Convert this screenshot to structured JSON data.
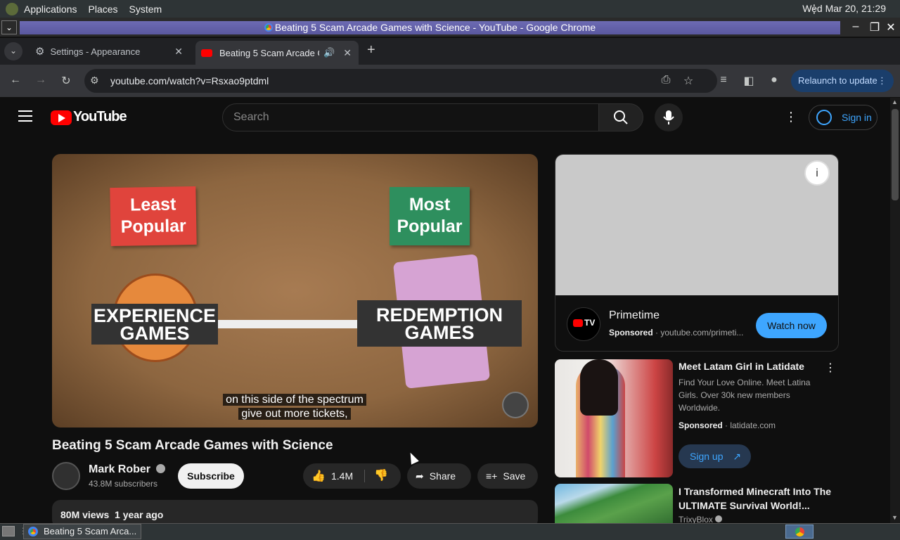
{
  "desktop": {
    "menus": [
      "Applications",
      "Places",
      "System"
    ],
    "clock": "Wed Mar 20, 21:29"
  },
  "window": {
    "title": "Beating 5 Scam Arcade Games with Science - YouTube - Google Chrome"
  },
  "tabs": [
    {
      "label": "Settings - Appearance"
    },
    {
      "label": "Beating 5 Scam Arcade G"
    }
  ],
  "toolbar": {
    "url": "youtube.com/watch?v=Rsxao9ptdml",
    "relaunch_label": "Relaunch to update"
  },
  "youtube": {
    "logo_text": "YouTube",
    "search_placeholder": "Search",
    "signin_label": "Sign in",
    "video": {
      "notes": [
        "Least Popular",
        "Most Popular"
      ],
      "labels": [
        "EXPERIENCE GAMES",
        "REDEMPTION GAMES"
      ],
      "caption_line1": "on this side of the spectrum",
      "caption_line2": "give out more tickets,"
    },
    "title": "Beating 5 Scam Arcade Games with Science",
    "channel": "Mark Rober",
    "subscribers": "43.8M subscribers",
    "subscribe_label": "Subscribe",
    "likes": "1.4M",
    "share_label": "Share",
    "save_label": "Save",
    "views_date": "80M views  1 year ago",
    "ad": {
      "title": "Primetime",
      "sponsored": "Sponsored",
      "domain": "youtube.com/primeti...",
      "cta": "Watch now",
      "logo_text": "TV"
    },
    "ad2": {
      "title": "Meet Latam Girl in Latidate",
      "description": "Find Your Love Online. Meet Latina Girls. Over 30k new members Worldwide.",
      "sponsored": "Sponsored",
      "domain": "latidate.com",
      "cta": "Sign up"
    },
    "recommendation": {
      "title": "I Transformed Minecraft Into The ULTIMATE Survival World!...",
      "channel": "TrixyBlox"
    }
  },
  "taskbar": {
    "item_label": "Beating 5 Scam Arca..."
  }
}
